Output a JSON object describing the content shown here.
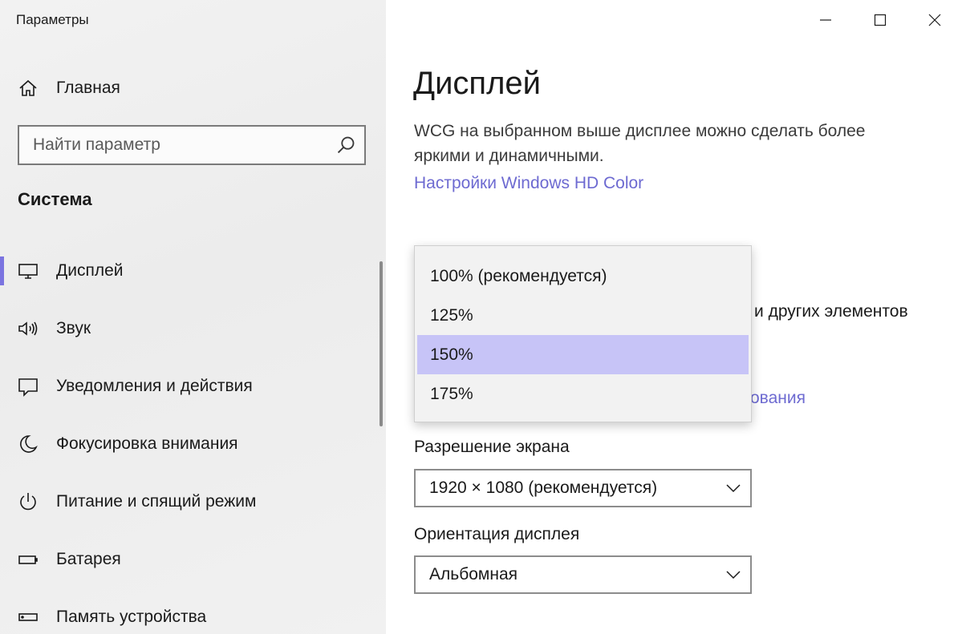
{
  "window": {
    "title": "Параметры",
    "controls": [
      "minimize-icon",
      "maximize-icon",
      "close-icon"
    ]
  },
  "sidebar": {
    "home_label": "Главная",
    "search": {
      "placeholder": "Найти параметр"
    },
    "section_title": "Система",
    "items": [
      {
        "label": "Дисплей",
        "icon": "monitor-icon",
        "active": true
      },
      {
        "label": "Звук",
        "icon": "speaker-icon"
      },
      {
        "label": "Уведомления и действия",
        "icon": "notification-icon"
      },
      {
        "label": "Фокусировка внимания",
        "icon": "moon-icon"
      },
      {
        "label": "Питание и спящий режим",
        "icon": "power-icon"
      },
      {
        "label": "Батарея",
        "icon": "battery-icon"
      },
      {
        "label": "Память устройства",
        "icon": "storage-icon"
      }
    ]
  },
  "main": {
    "page_title": "Дисплей",
    "description": "WCG на выбранном выше дисплее можно сделать более яркими и динамичными.",
    "hd_color_link": "Настройки Windows HD Color",
    "partially_hidden_text": "и других элементов",
    "partially_hidden_link": "ования",
    "scale_dropdown": {
      "options": [
        "100% (рекомендуется)",
        "125%",
        "150%",
        "175%"
      ],
      "highlighted": "150%"
    },
    "resolution": {
      "label": "Разрешение экрана",
      "value": "1920 × 1080 (рекомендуется)"
    },
    "orientation": {
      "label": "Ориентация дисплея",
      "value": "Альбомная"
    }
  },
  "colors": {
    "accent": "#7b74e0",
    "link": "#6d6ad1",
    "highlight": "#c7c4f7"
  }
}
